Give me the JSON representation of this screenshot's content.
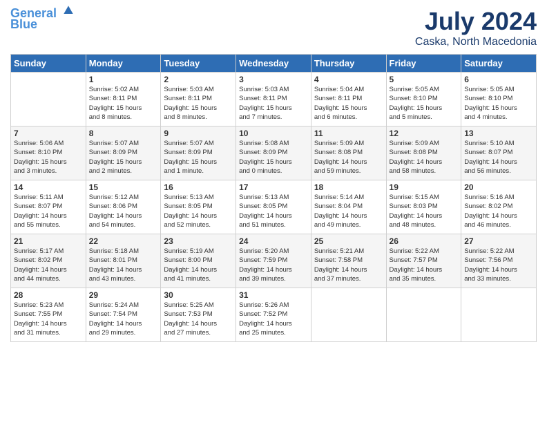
{
  "header": {
    "logo_line1": "General",
    "logo_line2": "Blue",
    "month_year": "July 2024",
    "location": "Caska, North Macedonia"
  },
  "weekdays": [
    "Sunday",
    "Monday",
    "Tuesday",
    "Wednesday",
    "Thursday",
    "Friday",
    "Saturday"
  ],
  "weeks": [
    [
      {
        "day": "",
        "info": ""
      },
      {
        "day": "1",
        "info": "Sunrise: 5:02 AM\nSunset: 8:11 PM\nDaylight: 15 hours\nand 8 minutes."
      },
      {
        "day": "2",
        "info": "Sunrise: 5:03 AM\nSunset: 8:11 PM\nDaylight: 15 hours\nand 8 minutes."
      },
      {
        "day": "3",
        "info": "Sunrise: 5:03 AM\nSunset: 8:11 PM\nDaylight: 15 hours\nand 7 minutes."
      },
      {
        "day": "4",
        "info": "Sunrise: 5:04 AM\nSunset: 8:11 PM\nDaylight: 15 hours\nand 6 minutes."
      },
      {
        "day": "5",
        "info": "Sunrise: 5:05 AM\nSunset: 8:10 PM\nDaylight: 15 hours\nand 5 minutes."
      },
      {
        "day": "6",
        "info": "Sunrise: 5:05 AM\nSunset: 8:10 PM\nDaylight: 15 hours\nand 4 minutes."
      }
    ],
    [
      {
        "day": "7",
        "info": "Sunrise: 5:06 AM\nSunset: 8:10 PM\nDaylight: 15 hours\nand 3 minutes."
      },
      {
        "day": "8",
        "info": "Sunrise: 5:07 AM\nSunset: 8:09 PM\nDaylight: 15 hours\nand 2 minutes."
      },
      {
        "day": "9",
        "info": "Sunrise: 5:07 AM\nSunset: 8:09 PM\nDaylight: 15 hours\nand 1 minute."
      },
      {
        "day": "10",
        "info": "Sunrise: 5:08 AM\nSunset: 8:09 PM\nDaylight: 15 hours\nand 0 minutes."
      },
      {
        "day": "11",
        "info": "Sunrise: 5:09 AM\nSunset: 8:08 PM\nDaylight: 14 hours\nand 59 minutes."
      },
      {
        "day": "12",
        "info": "Sunrise: 5:09 AM\nSunset: 8:08 PM\nDaylight: 14 hours\nand 58 minutes."
      },
      {
        "day": "13",
        "info": "Sunrise: 5:10 AM\nSunset: 8:07 PM\nDaylight: 14 hours\nand 56 minutes."
      }
    ],
    [
      {
        "day": "14",
        "info": "Sunrise: 5:11 AM\nSunset: 8:07 PM\nDaylight: 14 hours\nand 55 minutes."
      },
      {
        "day": "15",
        "info": "Sunrise: 5:12 AM\nSunset: 8:06 PM\nDaylight: 14 hours\nand 54 minutes."
      },
      {
        "day": "16",
        "info": "Sunrise: 5:13 AM\nSunset: 8:05 PM\nDaylight: 14 hours\nand 52 minutes."
      },
      {
        "day": "17",
        "info": "Sunrise: 5:13 AM\nSunset: 8:05 PM\nDaylight: 14 hours\nand 51 minutes."
      },
      {
        "day": "18",
        "info": "Sunrise: 5:14 AM\nSunset: 8:04 PM\nDaylight: 14 hours\nand 49 minutes."
      },
      {
        "day": "19",
        "info": "Sunrise: 5:15 AM\nSunset: 8:03 PM\nDaylight: 14 hours\nand 48 minutes."
      },
      {
        "day": "20",
        "info": "Sunrise: 5:16 AM\nSunset: 8:02 PM\nDaylight: 14 hours\nand 46 minutes."
      }
    ],
    [
      {
        "day": "21",
        "info": "Sunrise: 5:17 AM\nSunset: 8:02 PM\nDaylight: 14 hours\nand 44 minutes."
      },
      {
        "day": "22",
        "info": "Sunrise: 5:18 AM\nSunset: 8:01 PM\nDaylight: 14 hours\nand 43 minutes."
      },
      {
        "day": "23",
        "info": "Sunrise: 5:19 AM\nSunset: 8:00 PM\nDaylight: 14 hours\nand 41 minutes."
      },
      {
        "day": "24",
        "info": "Sunrise: 5:20 AM\nSunset: 7:59 PM\nDaylight: 14 hours\nand 39 minutes."
      },
      {
        "day": "25",
        "info": "Sunrise: 5:21 AM\nSunset: 7:58 PM\nDaylight: 14 hours\nand 37 minutes."
      },
      {
        "day": "26",
        "info": "Sunrise: 5:22 AM\nSunset: 7:57 PM\nDaylight: 14 hours\nand 35 minutes."
      },
      {
        "day": "27",
        "info": "Sunrise: 5:22 AM\nSunset: 7:56 PM\nDaylight: 14 hours\nand 33 minutes."
      }
    ],
    [
      {
        "day": "28",
        "info": "Sunrise: 5:23 AM\nSunset: 7:55 PM\nDaylight: 14 hours\nand 31 minutes."
      },
      {
        "day": "29",
        "info": "Sunrise: 5:24 AM\nSunset: 7:54 PM\nDaylight: 14 hours\nand 29 minutes."
      },
      {
        "day": "30",
        "info": "Sunrise: 5:25 AM\nSunset: 7:53 PM\nDaylight: 14 hours\nand 27 minutes."
      },
      {
        "day": "31",
        "info": "Sunrise: 5:26 AM\nSunset: 7:52 PM\nDaylight: 14 hours\nand 25 minutes."
      },
      {
        "day": "",
        "info": ""
      },
      {
        "day": "",
        "info": ""
      },
      {
        "day": "",
        "info": ""
      }
    ]
  ]
}
